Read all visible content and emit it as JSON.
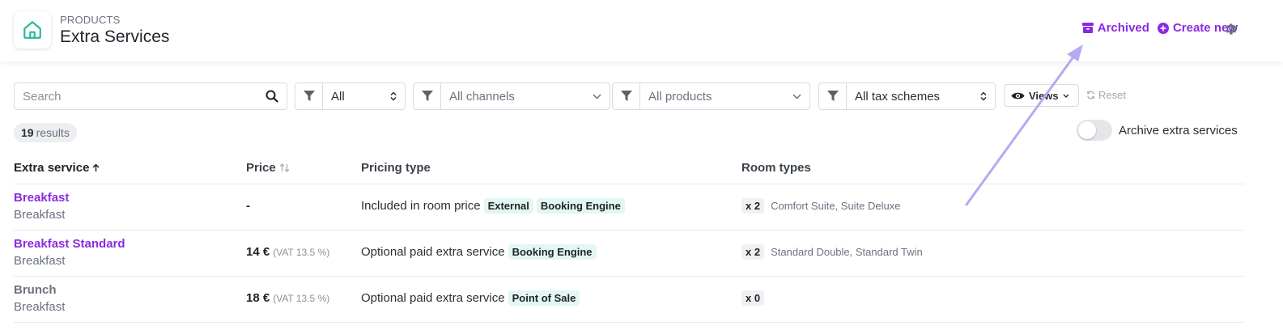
{
  "header": {
    "eyebrow": "PRODUCTS",
    "title": "Extra Services",
    "archived_label": "Archived",
    "create_label": "Create new",
    "accent_color": "#8a2be2",
    "logo_color": "#2bb79a"
  },
  "filters": {
    "search_placeholder": "Search",
    "status_value": "All",
    "channels_value": "All channels",
    "products_value": "All products",
    "tax_value": "All tax schemes",
    "views_label": "Views",
    "reset_label": "Reset"
  },
  "summary": {
    "count": "19",
    "label": "results",
    "toggle_label": "Archive extra services"
  },
  "table": {
    "headers": {
      "name": "Extra service",
      "price": "Price",
      "pricing_type": "Pricing type",
      "room_types": "Room types"
    },
    "rows": [
      {
        "name": "Breakfast",
        "category": "Breakfast",
        "price": "-",
        "vat": "",
        "pricing_type": "Included in room price",
        "tags": [
          "External",
          "Booking Engine"
        ],
        "room_count": "x 2",
        "room_types": "Comfort Suite, Suite Deluxe"
      },
      {
        "name": "Breakfast Standard",
        "category": "Breakfast",
        "price": "14 €",
        "vat": "(VAT 13.5 %)",
        "pricing_type": "Optional paid extra service",
        "tags": [
          "Booking Engine"
        ],
        "room_count": "x 2",
        "room_types": "Standard Double, Standard Twin"
      },
      {
        "name": "Brunch",
        "category": "Breakfast",
        "price": "18 €",
        "vat": "(VAT 13.5 %)",
        "pricing_type": "Optional paid extra service",
        "tags": [
          "Point of Sale"
        ],
        "room_count": "x 0",
        "room_types": ""
      }
    ]
  }
}
